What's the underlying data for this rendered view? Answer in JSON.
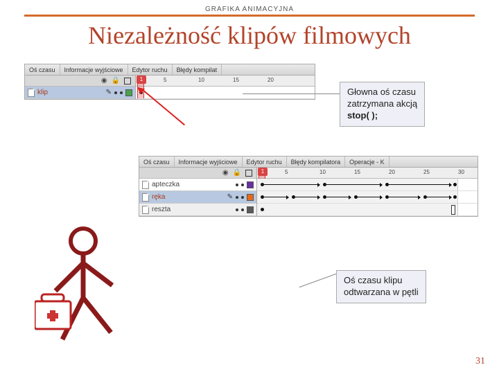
{
  "header": {
    "kicker": "GRAFIKA ANIMACYJNA"
  },
  "title": "Niezależność klipów filmowych",
  "timeline1": {
    "tabs": [
      "Oś czasu",
      "Informacje wyjściowe",
      "Edytor ruchu",
      "Błędy kompilat"
    ],
    "ruler": [
      "5",
      "10",
      "15",
      "20"
    ],
    "playhead": "1",
    "layers": [
      {
        "name": "klip",
        "selected": true,
        "swatch": "#4aa24a"
      }
    ]
  },
  "timeline2": {
    "tabs": [
      "Oś czasu",
      "Informacje wyjściowe",
      "Edytor ruchu",
      "Błędy kompilatora",
      "Operacje - K"
    ],
    "ruler": [
      "5",
      "10",
      "15",
      "20",
      "25",
      "30"
    ],
    "playhead": "1",
    "layers": [
      {
        "name": "apteczka",
        "selected": false,
        "swatch": "#6a2fa5"
      },
      {
        "name": "ręka",
        "selected": true,
        "swatch": "#e66a1a"
      },
      {
        "name": "reszta",
        "selected": false,
        "swatch": "#5a5a5a"
      }
    ]
  },
  "callouts": {
    "main": {
      "l1": "Głowna oś czasu",
      "l2": "zatrzymana akcją",
      "l3": "stop( );"
    },
    "clip": {
      "l1": "Oś czasu klipu",
      "l2": "odtwarzana w pętli"
    }
  },
  "pagenum": "31"
}
